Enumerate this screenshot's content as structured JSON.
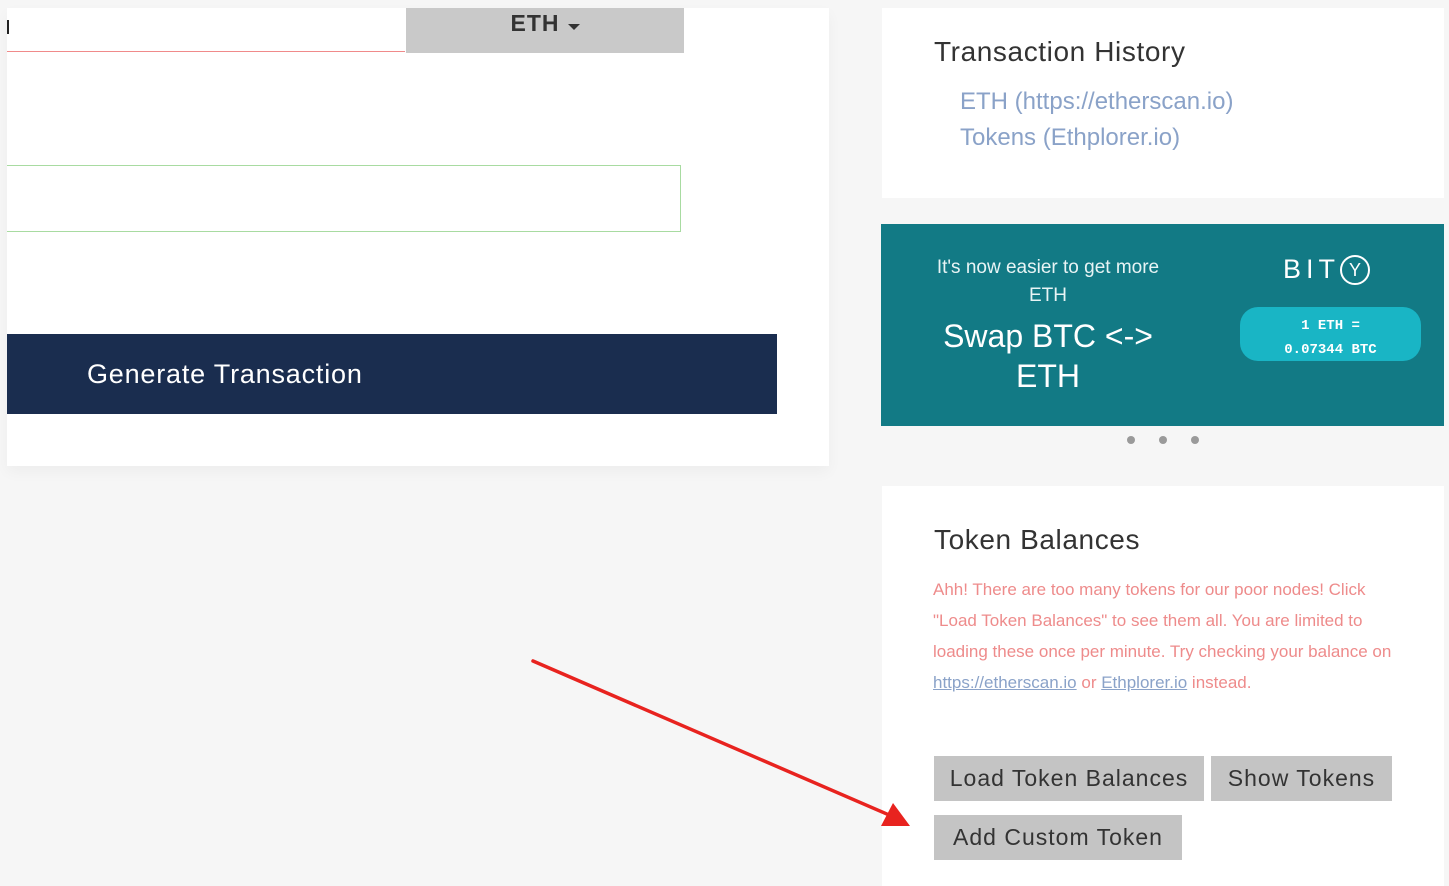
{
  "send_form": {
    "amount_value": "",
    "unit_dropdown_label": "ETH",
    "gas_limit_value": "",
    "generate_button_label": "Generate Transaction"
  },
  "transaction_history": {
    "title": "Transaction History",
    "links": [
      {
        "label": "ETH (https://etherscan.io)"
      },
      {
        "label": "Tokens (Ethplorer.io)"
      }
    ]
  },
  "promo": {
    "tagline_line1": "It's now easier to get more",
    "tagline_line2": "ETH",
    "headline_line1": "Swap BTC <->",
    "headline_line2": "ETH",
    "logo_text": "BIT",
    "logo_mark": "Y",
    "rate_line1": "1 ETH =",
    "rate_line2": "0.07344 BTC",
    "dots": 3,
    "accent_color": "#127a85",
    "pill_color": "#19b5c5"
  },
  "token_balances": {
    "title": "Token Balances",
    "warning_part1": "Ahh! There are too many tokens for our poor nodes! Click \"Load Token Balances\" to see them all. You are limited to loading these once per minute. Try checking your balance on ",
    "warning_link1": "https://etherscan.io",
    "warning_or": " or ",
    "warning_link2": "Ethplorer.io",
    "warning_part2": " instead.",
    "load_button_label": "Load Token Balances",
    "show_button_label": "Show Tokens",
    "add_custom_button_label": "Add Custom Token"
  },
  "annotation": {
    "arrow_color": "#e8231f",
    "arrow_target": "Add Custom Token"
  },
  "colors": {
    "navy_button": "#1a2d4f",
    "link_blue": "#8aa2c8",
    "warning_red": "#ee8b8b",
    "gray_button": "#c4c4c4"
  }
}
